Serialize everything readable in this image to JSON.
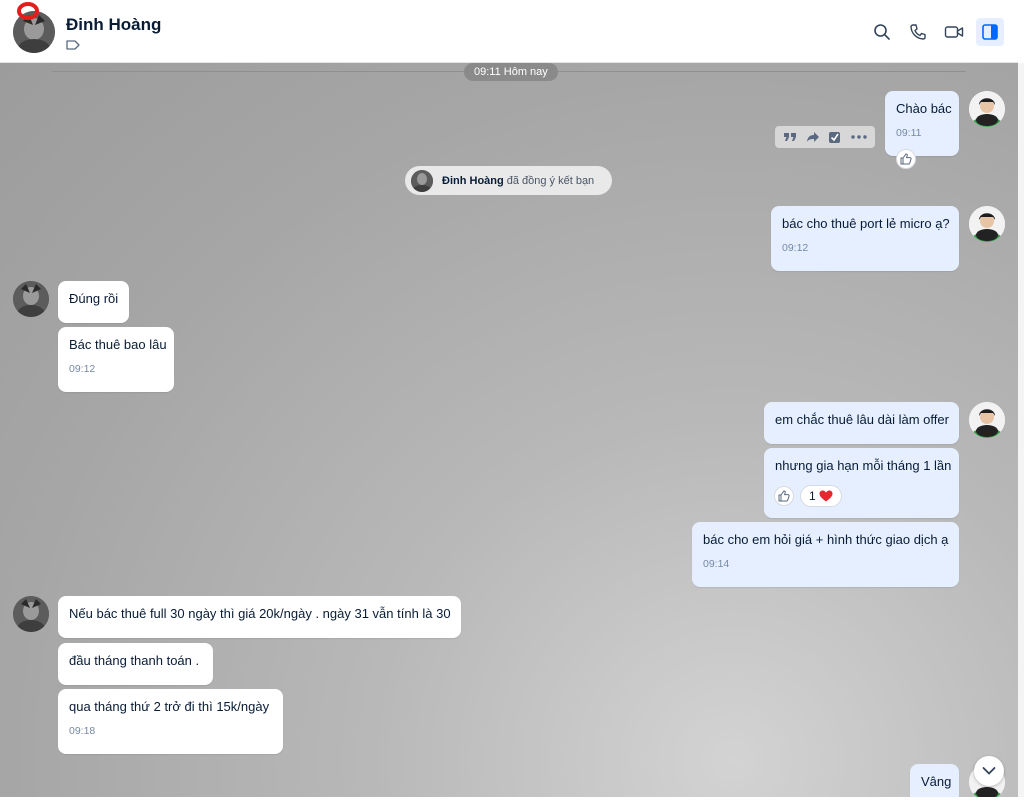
{
  "header": {
    "contact_name": "Đinh Hoàng",
    "icons": [
      "search-icon",
      "phone-icon",
      "video-icon",
      "sidebar-toggle-icon"
    ]
  },
  "chat": {
    "date_divider": "09:11 Hôm nay",
    "system_message": {
      "name": "Đinh Hoàng",
      "text": "đã đồng ý kết bạn"
    },
    "messages": [
      {
        "side": "me",
        "text": "Chào bác",
        "time": "09:11"
      },
      {
        "side": "me",
        "text": "bác cho thuê port lẻ micro ạ?",
        "time": "09:12"
      },
      {
        "side": "them",
        "text": "Đúng rồi",
        "time": ""
      },
      {
        "side": "them",
        "text": "Bác thuê bao lâu",
        "time": "09:12"
      },
      {
        "side": "me",
        "text": "em chắc thuê lâu dài làm offer",
        "time": ""
      },
      {
        "side": "me",
        "text": "nhưng gia hạn mỗi tháng 1 lần",
        "time": ""
      },
      {
        "side": "me",
        "text": "bác cho em hỏi giá + hình thức giao dịch ạ",
        "time": "09:14"
      },
      {
        "side": "them",
        "text": "Nếu bác thuê full 30 ngày thì giá 20k/ngày . ngày 31 vẫn tính là 30",
        "time": ""
      },
      {
        "side": "them",
        "text": "đầu tháng thanh toán .",
        "time": ""
      },
      {
        "side": "them",
        "text": "qua tháng thứ 2 trở đi thì 15k/ngày",
        "time": "09:18"
      },
      {
        "side": "me",
        "text": "Vâng",
        "time": ""
      }
    ],
    "reaction_count": "1",
    "reaction_emoji": "❤"
  },
  "colors": {
    "my_bubble": "#e5efff",
    "their_bubble": "#ffffff",
    "accent": "#0068ff",
    "heart": "#e8262d"
  }
}
